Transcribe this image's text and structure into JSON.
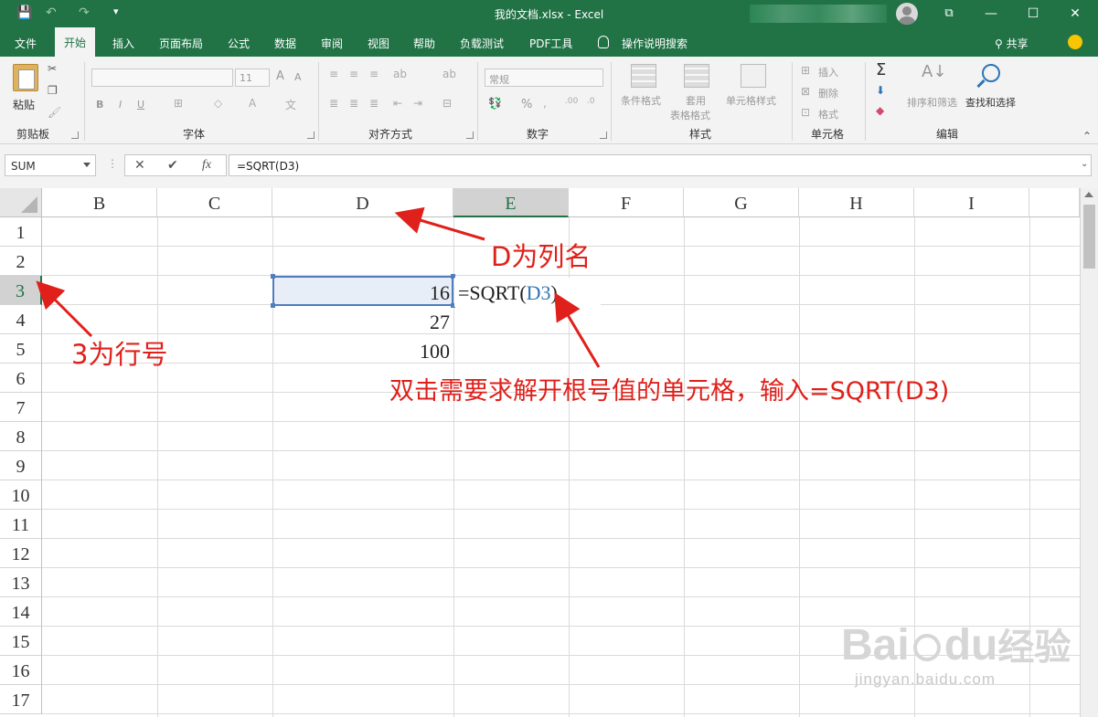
{
  "window": {
    "title": "我的文档.xlsx  -  Excel",
    "controls": {
      "minimize": "—",
      "maximize": "☐",
      "close": "✕",
      "ribbon_display": "⧉"
    },
    "quick_access": {
      "save": "💾",
      "undo": "↶",
      "redo": "↷",
      "customize": "▾"
    }
  },
  "tabs": [
    "文件",
    "开始",
    "插入",
    "页面布局",
    "公式",
    "数据",
    "审阅",
    "视图",
    "帮助",
    "负载测试",
    "PDF工具",
    "操作说明搜索"
  ],
  "active_tab": "开始",
  "share_label": "共享",
  "ribbon": {
    "clipboard": {
      "paste": "粘贴",
      "label": "剪贴板"
    },
    "font": {
      "name": "",
      "size": "11",
      "bold": "B",
      "italic": "I",
      "underline": "U",
      "label": "字体",
      "grow": "A",
      "shrink": "A"
    },
    "alignment": {
      "label": "对齐方式"
    },
    "number": {
      "format": "常规",
      "label": "数字",
      "percent": "%"
    },
    "styles": {
      "conditional": "条件格式",
      "table_1": "套用",
      "table_2": "表格格式",
      "cell_styles": "单元格样式",
      "label": "样式"
    },
    "cells": {
      "insert": "插入",
      "delete": "删除",
      "format": "格式",
      "label": "单元格"
    },
    "editing": {
      "sum": "Σ",
      "sort": "排序和筛选",
      "find": "查找和选择",
      "label": "编辑"
    }
  },
  "formula_bar": {
    "name_box": "SUM",
    "cancel": "✕",
    "enter": "✔",
    "fx": "fx",
    "formula": "=SQRT(D3)"
  },
  "sheet": {
    "columns": [
      "B",
      "C",
      "D",
      "E",
      "F",
      "G",
      "H",
      "I"
    ],
    "active_column": "E",
    "rows": [
      "1",
      "2",
      "3",
      "4",
      "5",
      "6",
      "7",
      "8",
      "9",
      "10",
      "11",
      "12",
      "13",
      "14",
      "15",
      "16",
      "17"
    ],
    "active_row": "3",
    "cells": {
      "D3": "16",
      "D4": "27",
      "D5": "100",
      "E3_prefix": "=SQRT(",
      "E3_ref": "D3",
      "E3_suffix": ")"
    }
  },
  "annotations": {
    "column_note": "D为列名",
    "row_note": "3为行号",
    "instruction": "双击需要求解开根号值的单元格，输入=SQRT(D3)",
    "color": "#e0201a"
  },
  "watermark": {
    "brand": "Bai",
    "brand_mid": "du",
    "brand_cn": "经验",
    "url": "jingyan.baidu.com"
  },
  "colors": {
    "excel_green": "#217346",
    "selection_border": "#4f7dbd",
    "reference_blue": "#2e75b6"
  }
}
